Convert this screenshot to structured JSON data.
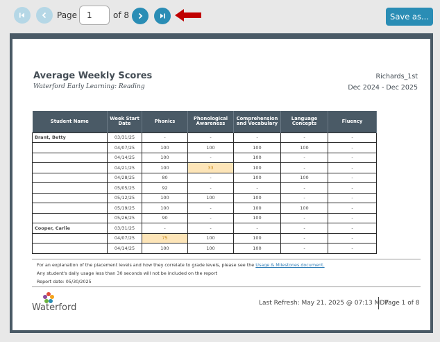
{
  "toolbar": {
    "page_label": "Page",
    "page_value": "1",
    "of_label": "of 8",
    "save_label": "Save as...",
    "icons": [
      "first-page-icon",
      "prev-page-icon",
      "next-page-icon",
      "last-page-icon",
      "red-arrow-icon"
    ]
  },
  "report": {
    "title": "Average Weekly Scores",
    "subtitle": "Waterford Early Learning: Reading",
    "class_name": "Richards_1st",
    "date_range": "Dec 2024 - Dec 2025",
    "columns": [
      "Student Name",
      "Week Start Date",
      "Phonics",
      "Phonological Awareness",
      "Comprehension and Vocabulary",
      "Language Concepts",
      "Fluency"
    ],
    "rows": [
      {
        "name": "Brant, Betty",
        "date": "03/31/25",
        "phon": "-",
        "pa": "-",
        "cv": "-",
        "lc": "-",
        "fl": "-"
      },
      {
        "name": "",
        "date": "04/07/25",
        "phon": "100",
        "pa": "100",
        "cv": "100",
        "lc": "100",
        "fl": "-"
      },
      {
        "name": "",
        "date": "04/14/25",
        "phon": "100",
        "pa": "-",
        "cv": "100",
        "lc": "-",
        "fl": "-"
      },
      {
        "name": "",
        "date": "04/21/25",
        "phon": "100",
        "pa": "33",
        "cv": "100",
        "lc": "-",
        "fl": "-",
        "hl": "pa"
      },
      {
        "name": "",
        "date": "04/28/25",
        "phon": "80",
        "pa": "-",
        "cv": "100",
        "lc": "100",
        "fl": "-"
      },
      {
        "name": "",
        "date": "05/05/25",
        "phon": "92",
        "pa": "-",
        "cv": "-",
        "lc": "-",
        "fl": "-"
      },
      {
        "name": "",
        "date": "05/12/25",
        "phon": "100",
        "pa": "100",
        "cv": "100",
        "lc": "-",
        "fl": "-"
      },
      {
        "name": "",
        "date": "05/19/25",
        "phon": "100",
        "pa": "-",
        "cv": "100",
        "lc": "100",
        "fl": "-"
      },
      {
        "name": "",
        "date": "05/26/25",
        "phon": "90",
        "pa": "-",
        "cv": "100",
        "lc": "-",
        "fl": "-"
      },
      {
        "name": "Cooper, Carlie",
        "date": "03/31/25",
        "phon": "-",
        "pa": "-",
        "cv": "-",
        "lc": "-",
        "fl": "-"
      },
      {
        "name": "",
        "date": "04/07/25",
        "phon": "75",
        "pa": "100",
        "cv": "100",
        "lc": "-",
        "fl": "-",
        "hl": "phon"
      },
      {
        "name": "",
        "date": "04/14/25",
        "phon": "100",
        "pa": "100",
        "cv": "100",
        "lc": "-",
        "fl": "-"
      }
    ],
    "note1_prefix": "For an explanation of the placement levels and how they correlate to grade levels, please see the ",
    "note1_link": "Usage & Milestones document.",
    "note2": "Any student's daily usage less than 30 seconds will not be included on the report",
    "note3": "Report date: 05/30/2025",
    "logo_text": "Waterford",
    "refresh": "Last Refresh: May 21, 2025 @ 07:13 MDT",
    "page_of": "Page 1 of 8"
  },
  "colors": {
    "accent": "#2a8db5",
    "header_bg": "#4a5a66",
    "highlight": "#fde5b8",
    "annotation_arrow": "#c00000"
  }
}
